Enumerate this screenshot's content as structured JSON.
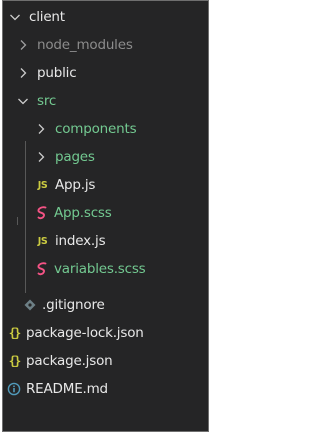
{
  "explorer": {
    "root": {
      "label": "client",
      "icon": "chevron-down-icon"
    },
    "items": [
      {
        "label": "node_modules",
        "icon": "chevron-right-icon"
      },
      {
        "label": "public",
        "icon": "chevron-right-icon"
      },
      {
        "label": "src",
        "icon": "chevron-down-icon"
      },
      {
        "label": "components",
        "icon": "chevron-right-icon"
      },
      {
        "label": "pages",
        "icon": "chevron-right-icon"
      },
      {
        "label": "App.js",
        "icon": "js-file-icon",
        "icon_text": "JS"
      },
      {
        "label": "App.scss",
        "icon": "sass-file-icon"
      },
      {
        "label": "index.js",
        "icon": "js-file-icon",
        "icon_text": "JS"
      },
      {
        "label": "variables.scss",
        "icon": "sass-file-icon"
      },
      {
        "label": ".gitignore",
        "icon": "git-file-icon"
      },
      {
        "label": "package-lock.json",
        "icon": "json-file-icon",
        "icon_text": "{}"
      },
      {
        "label": "package.json",
        "icon": "json-file-icon",
        "icon_text": "{}"
      },
      {
        "label": "README.md",
        "icon": "info-file-icon"
      }
    ]
  },
  "colors": {
    "background": "#252526",
    "text": "#cccccc",
    "ignored_text": "#8c8c8c",
    "untracked_text": "#73c991",
    "js_icon": "#cbcb41",
    "sass_icon": "#f55385",
    "json_icon": "#cbcb41",
    "info_icon": "#519aba",
    "git_icon": "#6d8086"
  }
}
